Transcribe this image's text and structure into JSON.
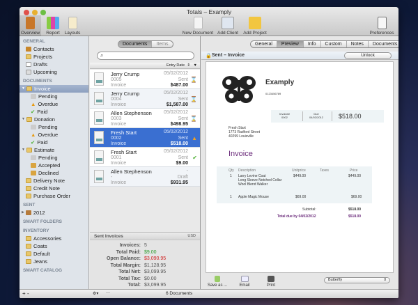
{
  "window": {
    "title": "Totals – Examply"
  },
  "toolbar": {
    "overview": "Overview",
    "report": "Report",
    "layouts": "Layouts",
    "new_document": "New Document",
    "add_client": "Add Client",
    "add_project": "Add Project",
    "preferences": "Preferences"
  },
  "sidebar": {
    "general_header": "GENERAL",
    "general": [
      "Contacts",
      "Projects",
      "Drafts",
      "Upcoming"
    ],
    "documents_header": "DOCUMENTS",
    "invoice": "Invoice",
    "invoice_children": [
      "Pending",
      "Overdue",
      "Paid"
    ],
    "donation": "Donation",
    "donation_children": [
      "Pending",
      "Overdue",
      "Paid"
    ],
    "estimate": "Estimate",
    "estimate_children": [
      "Pending",
      "Accepted",
      "Declined"
    ],
    "other_docs": [
      "Delivery Note",
      "Credit Note",
      "Purchase Order"
    ],
    "sent_header": "SENT",
    "sent_year": "2012",
    "smart_folders_header": "SMART FOLDERS",
    "inventory_header": "INVENTORY",
    "inventory": [
      "Accessories",
      "Coats",
      "Default",
      "Jeans"
    ],
    "smart_catalog_header": "SMART CATALOG",
    "add": "+",
    "remove": "-"
  },
  "list": {
    "tabs": [
      "Documents",
      "Items"
    ],
    "search_placeholder": "",
    "sort_label": "Entry Date",
    "rows": [
      {
        "name": "Jerry Crump",
        "number": "0005",
        "type": "Invoice",
        "date": "05/02/2012",
        "status": "Sent",
        "amount": "$487.00",
        "icon": "hourglass-icon"
      },
      {
        "name": "Jerry Crump",
        "number": "0004",
        "type": "Invoice",
        "date": "05/02/2012",
        "status": "Sent",
        "amount": "$1,587.00",
        "icon": "hourglass-icon"
      },
      {
        "name": "Allen Stephenson",
        "number": "0003",
        "type": "Invoice",
        "date": "05/02/2012",
        "status": "Sent",
        "amount": "$498.95",
        "icon": "hourglass-icon"
      },
      {
        "name": "Fresh Start",
        "number": "0002",
        "type": "Invoice",
        "date": "05/02/2012",
        "status": "Sent",
        "amount": "$518.00",
        "icon": "warning-icon"
      },
      {
        "name": "Fresh Start",
        "number": "0001",
        "type": "Invoice",
        "date": "05/02/2012",
        "status": "Sent",
        "amount": "$9.00",
        "icon": "check-icon"
      },
      {
        "name": "Allen Stephenson",
        "number": "-",
        "type": "Invoice",
        "date": "-",
        "status": "Draft",
        "amount": "$931.95",
        "icon": ""
      }
    ],
    "summary_title": "Sent Invoices",
    "currency": "USD",
    "stats": [
      {
        "label": "Invoices:",
        "value": "5",
        "color": "#555555"
      },
      {
        "label": "Total Paid:",
        "value": "$9.00",
        "color": "#2a9a2a"
      },
      {
        "label": "Open Balance:",
        "value": "$3,090.95",
        "color": "#d02020"
      },
      {
        "label": "Total Margin:",
        "value": "$1,128.95",
        "color": "#555555"
      },
      {
        "label": "Total Net:",
        "value": "$3,099.95",
        "color": "#555555"
      },
      {
        "label": "Total Tax:",
        "value": "$0.00",
        "color": "#555555"
      },
      {
        "label": "Total:",
        "value": "$3,099.95",
        "color": "#555555"
      }
    ],
    "count": "6 Documents",
    "gear": "⚙▾",
    "minus": "—"
  },
  "detail": {
    "tabs": [
      "General",
      "Preview",
      "Info",
      "Custom",
      "Notes",
      "Documents"
    ],
    "status": "Sent – Invoice",
    "unlock": "Unlock",
    "doc": {
      "company": "Examply",
      "phone": "0123456789",
      "invoice_no_label": "Invoice#",
      "invoice_no": "0002",
      "due_label": "Due",
      "due": "04/02/2012",
      "total": "$518.00",
      "client": [
        "Fresh Start",
        "1773 Radford Street",
        "40299 Louisville"
      ],
      "heading": "Invoice",
      "cols": [
        "Qty",
        "Description",
        "Unitprice",
        "Taxes",
        "Price"
      ],
      "items": [
        {
          "qty": "1",
          "desc": [
            "Larry Levine Coat",
            "Long Sleeve Notched Collar",
            "Wool Blend Walker"
          ],
          "unit": "$449.00",
          "price": "$449.00"
        },
        {
          "qty": "1",
          "desc": [
            "Apple Magic Mouse"
          ],
          "unit": "$69.00",
          "price": "$69.00"
        }
      ],
      "subtotal_label": "Subtotal:",
      "subtotal": "$518.00",
      "totaldue_label": "Total due by 04/02/2012",
      "totaldue": "$518.00"
    },
    "footer": {
      "save": "Save as ...",
      "email": "Email",
      "print": "Print",
      "layout": "Butterfly"
    }
  },
  "colors": {
    "accent": "#3a6fd1",
    "invoice_purple": "#6a2a7a"
  }
}
